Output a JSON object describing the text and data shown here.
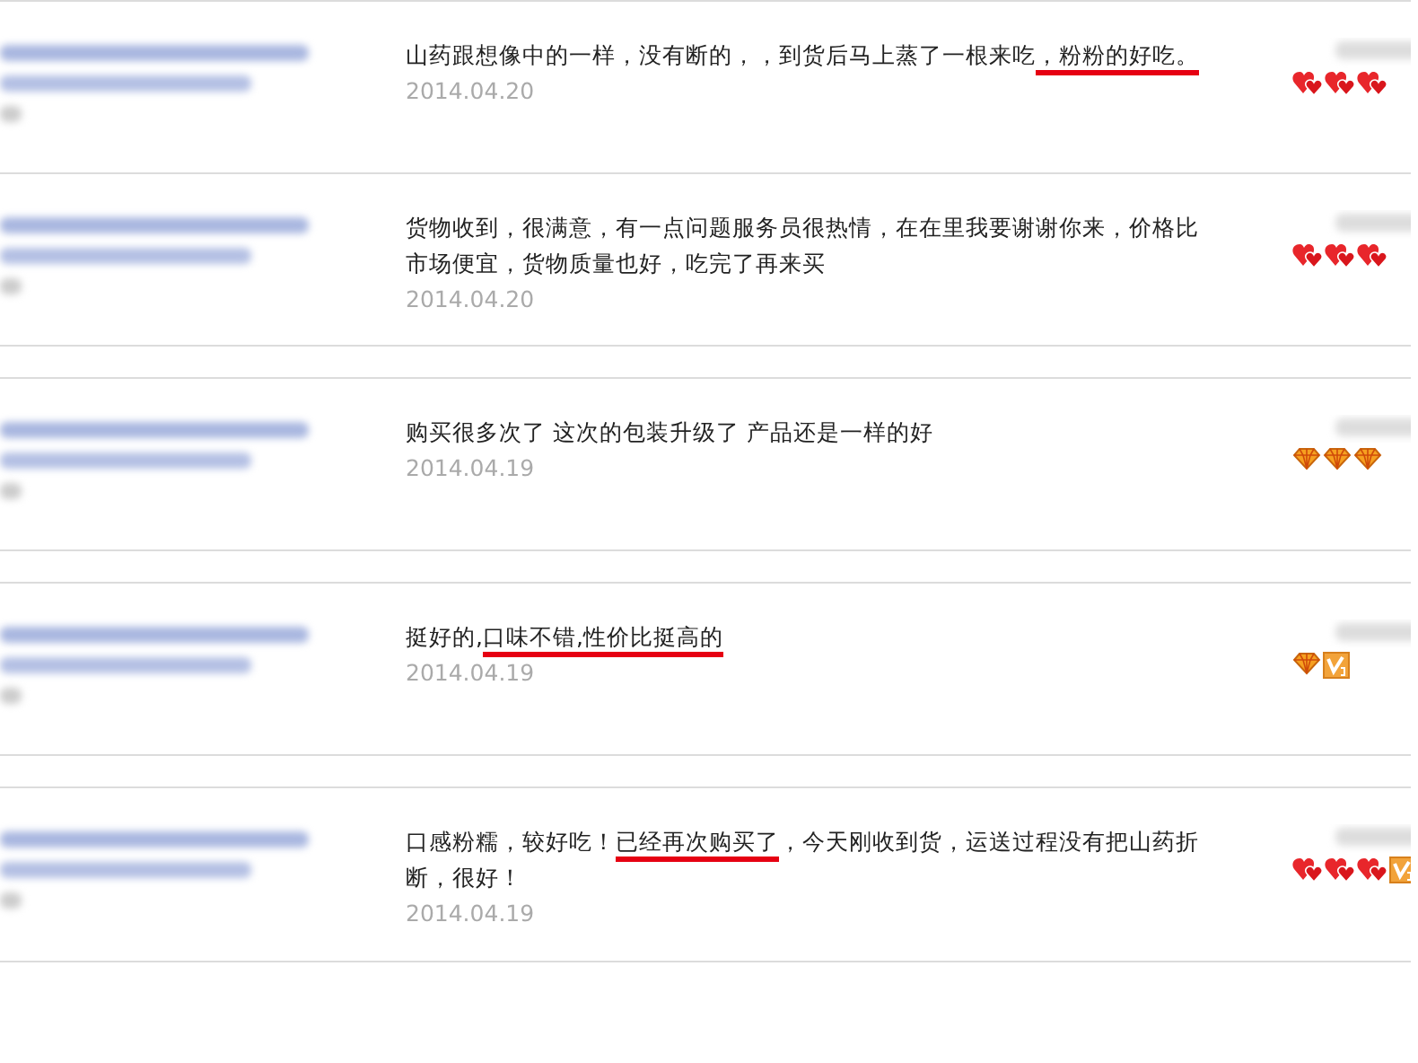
{
  "reviews": [
    {
      "comment": [
        {
          "text": "山药跟想像中的一样，没有断的，，到货后马上蒸了一根来吃",
          "marked": false
        },
        {
          "text": "，粉粉的好吃。",
          "marked": true
        }
      ],
      "date": "2014.04.20",
      "badges": [
        {
          "kind": "heart"
        },
        {
          "kind": "heart"
        },
        {
          "kind": "heart"
        }
      ]
    },
    {
      "comment": [
        {
          "text": "货物收到，很满意，有一点问题服务员很热情，在在里我要谢谢你来，价格比市场便宜，货物质量也好，吃完了再来买",
          "marked": false
        }
      ],
      "date": "2014.04.20",
      "badges": [
        {
          "kind": "heart"
        },
        {
          "kind": "heart"
        },
        {
          "kind": "heart"
        }
      ]
    },
    {
      "comment": [
        {
          "text": "购买很多次了 这次的包装升级了 产品还是一样的好",
          "marked": false
        }
      ],
      "date": "2014.04.19",
      "badges": [
        {
          "kind": "diamond"
        },
        {
          "kind": "diamond"
        },
        {
          "kind": "diamond"
        }
      ]
    },
    {
      "comment": [
        {
          "text": "挺好的,",
          "marked": false
        },
        {
          "text": "口味不错,性价比挺高的",
          "marked": true
        }
      ],
      "date": "2014.04.19",
      "badges": [
        {
          "kind": "diamond"
        },
        {
          "kind": "vip"
        }
      ]
    },
    {
      "comment": [
        {
          "text": "口感粉糯，较好吃！",
          "marked": false
        },
        {
          "text": "已经再次购买了",
          "marked": true
        },
        {
          "text": "，今天刚收到货，运送过程没有把山药折断，很好！",
          "marked": false
        }
      ],
      "date": "2014.04.19",
      "badges": [
        {
          "kind": "heart"
        },
        {
          "kind": "heart"
        },
        {
          "kind": "heart"
        },
        {
          "kind": "vip"
        }
      ]
    }
  ]
}
